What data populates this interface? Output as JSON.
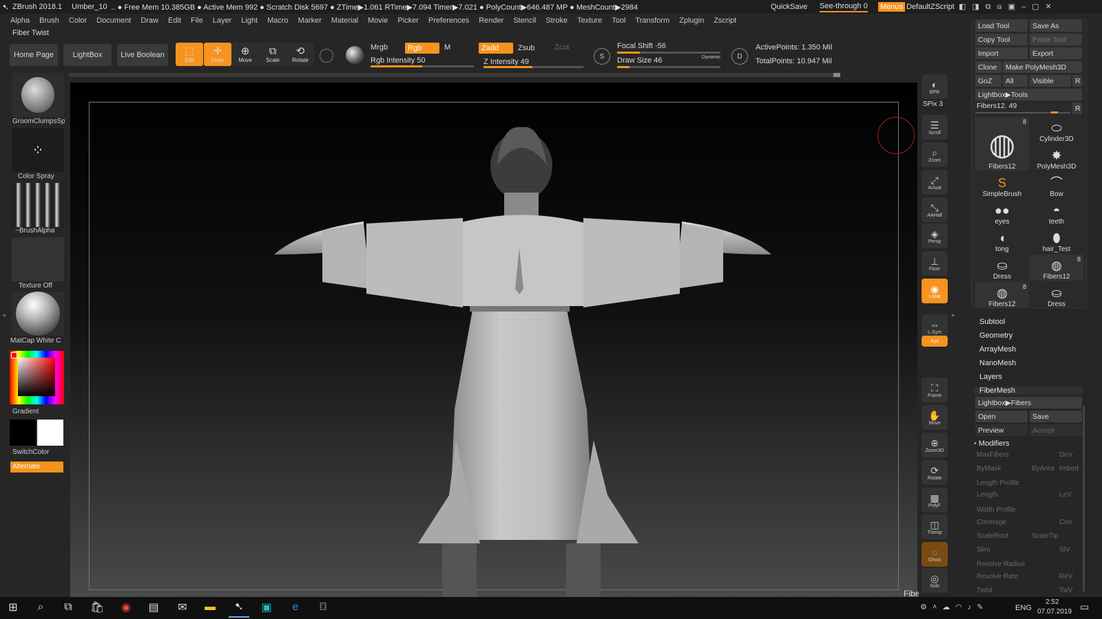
{
  "app": {
    "title": "ZBrush 2018.1",
    "file": "Umber_10",
    "stats": ".. ● Free Mem 10.385GB ● Active Mem 992 ● Scratch Disk 5697 ● ZTime▶1.061 RTime▶7.094 Timer▶7.021 ● PolyCount▶646.487 MP ● MeshCount▶2984",
    "quicksave": "QuickSave",
    "seethrough": "See-through  0",
    "menus": "Menus",
    "script": "DefaultZScript"
  },
  "menu": [
    "Alpha",
    "Brush",
    "Color",
    "Document",
    "Draw",
    "Edit",
    "File",
    "Layer",
    "Light",
    "Macro",
    "Marker",
    "Material",
    "Movie",
    "Picker",
    "Preferences",
    "Render",
    "Stencil",
    "Stroke",
    "Texture",
    "Tool",
    "Transform",
    "Zplugin",
    "Zscript"
  ],
  "toolbar": {
    "fiber_twist": "Fiber Twist",
    "home": "Home Page",
    "lightbox": "LightBox",
    "live_boolean": "Live Boolean",
    "edit": "Edit",
    "draw": "Draw",
    "move": "Move",
    "scale": "Scale",
    "rotate": "Rotate",
    "mrgb": "Mrgb",
    "rgb": "Rgb",
    "m": "M",
    "zadd": "Zadd",
    "zsub": "Zsub",
    "zcut": "Zcut",
    "rgb_intensity": "Rgb Intensity 50",
    "z_intensity": "Z Intensity 49",
    "focal_shift": "Focal Shift -56",
    "draw_size": "Draw Size 46",
    "dynamic": "Dynamic",
    "active_points": "ActivePoints: 1.350 Mil",
    "total_points": "TotalPoints: 10.947 Mil",
    "rgb_intensity_value": 0.5,
    "z_intensity_value": 0.49,
    "focal_value": 0.22,
    "drawsize_value": 0.12
  },
  "left": {
    "brush": "GroomClumpsSp",
    "stroke": "Color Spray",
    "alpha": "~BrushAlpha",
    "texture": "Texture Off",
    "material": "MatCap White C",
    "gradient": "Gradient",
    "switch": "SwitchColor",
    "alternate": "Alternate"
  },
  "right_icons": [
    "BPR",
    "SPix 3",
    "Scroll",
    "Zoom",
    "Actual",
    "AAHalf",
    "Persp",
    "Floor",
    "Local",
    "L.Sym",
    "Xyz",
    "Frame",
    "Move",
    "Zoom3D",
    "Rotate",
    "PolyF",
    "Transp",
    "Ghost",
    "Solo"
  ],
  "panel": {
    "load_tool": "Load Tool",
    "save_as": "Save As",
    "copy_tool": "Copy Tool",
    "paste_tool": "Paste Tool",
    "import": "Import",
    "export": "Export",
    "clone": "Clone",
    "make_polymesh": "Make PolyMesh3D",
    "goz": "GoZ",
    "all": "All",
    "visible": "Visible",
    "r": "R",
    "lightbox_tools": "Lightbox▶Tools",
    "current_tool": "Fibers12. 49",
    "tools": [
      {
        "label": "Fibers12",
        "badge": "8"
      },
      {
        "label": "Cylinder3D",
        "badge": ""
      },
      {
        "label": "PolyMesh3D",
        "badge": ""
      },
      {
        "label": "SimpleBrush",
        "badge": ""
      },
      {
        "label": "Bow",
        "badge": ""
      },
      {
        "label": "eyes",
        "badge": ""
      },
      {
        "label": "teeth",
        "badge": ""
      },
      {
        "label": "tong",
        "badge": ""
      },
      {
        "label": "hair_Test",
        "badge": ""
      },
      {
        "label": "Dress",
        "badge": ""
      },
      {
        "label": "Fibers12",
        "badge": "8"
      },
      {
        "label": "Fibers12",
        "badge": "8"
      },
      {
        "label": "Dress",
        "badge": ""
      }
    ],
    "sections": [
      "Subtool",
      "Geometry",
      "ArrayMesh",
      "NanoMesh",
      "Layers",
      "FiberMesh"
    ],
    "lightbox_fibers": "Lightbox▶Fibers",
    "open": "Open",
    "save": "Save",
    "preview": "Preview",
    "accept": "Accept",
    "modifiers": "Modifiers",
    "mods": [
      "MaxFibers",
      "DeV",
      "ByMask",
      "ByArea",
      "Imbed",
      "Length Profile",
      "Length",
      "LeV",
      "Width Profile",
      "Coverage",
      "CoV",
      "ScaleRoot",
      "ScaleTip",
      "Slim",
      "SlV",
      "Revolve Radius",
      "Revolve Rate",
      "ReV",
      "Twist",
      "TwV"
    ]
  },
  "status": {
    "fiber_twist": "Fiber Twist"
  },
  "taskbar": {
    "lang": "ENG",
    "time": "2:52",
    "date": "07.07.2019"
  },
  "colors": {
    "accent": "#f7931e"
  }
}
